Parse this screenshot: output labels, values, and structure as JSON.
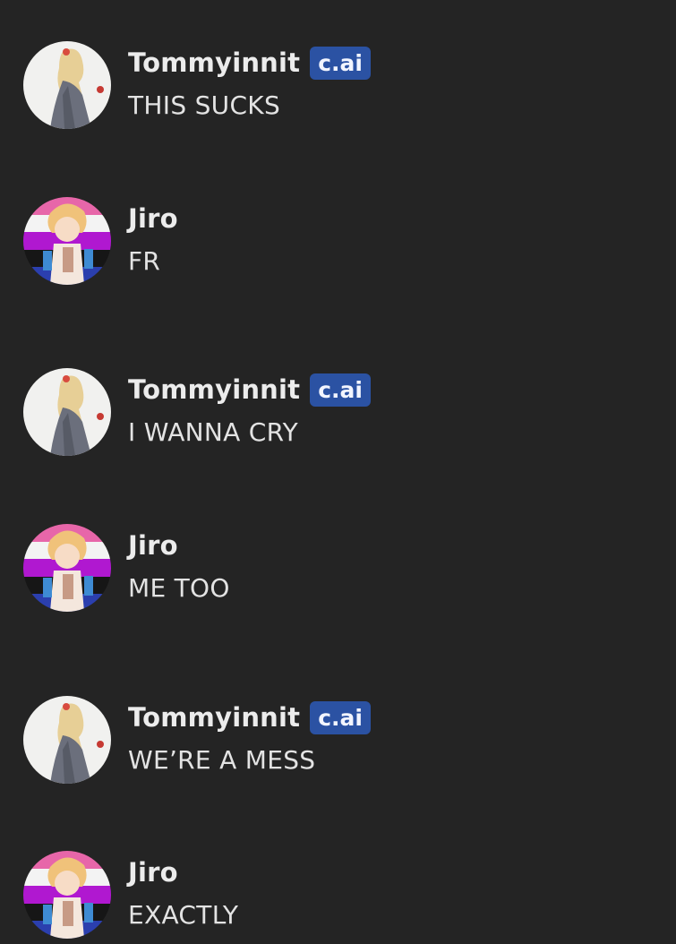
{
  "messages": [
    {
      "author": "Tommyinnit",
      "badge": "c.ai",
      "text": "THIS SUCKS",
      "avatar_icon": "tommyinnit-avatar"
    },
    {
      "author": "Jiro",
      "badge": "",
      "text": "FR",
      "avatar_icon": "jiro-avatar"
    },
    {
      "author": "Tommyinnit",
      "badge": "c.ai",
      "text": "I WANNA CRY",
      "avatar_icon": "tommyinnit-avatar"
    },
    {
      "author": "Jiro",
      "badge": "",
      "text": "ME TOO",
      "avatar_icon": "jiro-avatar"
    },
    {
      "author": "Tommyinnit",
      "badge": "c.ai",
      "text": "WE’RE A MESS",
      "avatar_icon": "tommyinnit-avatar"
    },
    {
      "author": "Jiro",
      "badge": "",
      "text": "EXACTLY",
      "avatar_icon": "jiro-avatar"
    }
  ],
  "colors": {
    "background": "#242424",
    "badge": "#2b52a3",
    "text": "#e3e3e3"
  }
}
